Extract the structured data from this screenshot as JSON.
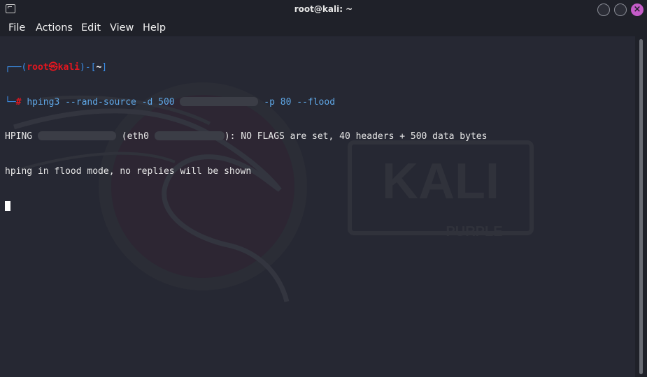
{
  "window": {
    "title": "root@kali: ~",
    "close_glyph": "×",
    "icons": [
      "terminal-icon",
      "minimize-button",
      "maximize-button",
      "close-icon"
    ]
  },
  "menu": [
    "File",
    "Actions",
    "Edit",
    "View",
    "Help"
  ],
  "terminal": {
    "prompt": {
      "box_top_left": "┌──(",
      "user": "root",
      "at_symbol": "㉿",
      "host": "kali",
      "close_paren": ")-[",
      "cwd": "~",
      "close_bracket": "]",
      "box_bottom": "└─",
      "hash": "#"
    },
    "command": {
      "part1": "hping3 --rand-source -d 500 ",
      "part2": " -p 80 --flood"
    },
    "output": [
      {
        "a": "HPING ",
        "b": " (eth0 ",
        "c": "): NO FLAGS are set, 40 headers + 500 data bytes"
      },
      {
        "a": "hping in flood mode, no replies will be shown"
      }
    ]
  },
  "background": {
    "logo_text": "KALI",
    "logo_subtext": "PURPLE"
  },
  "colors": {
    "accent_close": "#c45bc8",
    "prompt_blue": "#3b8ee8",
    "prompt_red": "#e5161f",
    "terminal_bg": "#262833"
  }
}
